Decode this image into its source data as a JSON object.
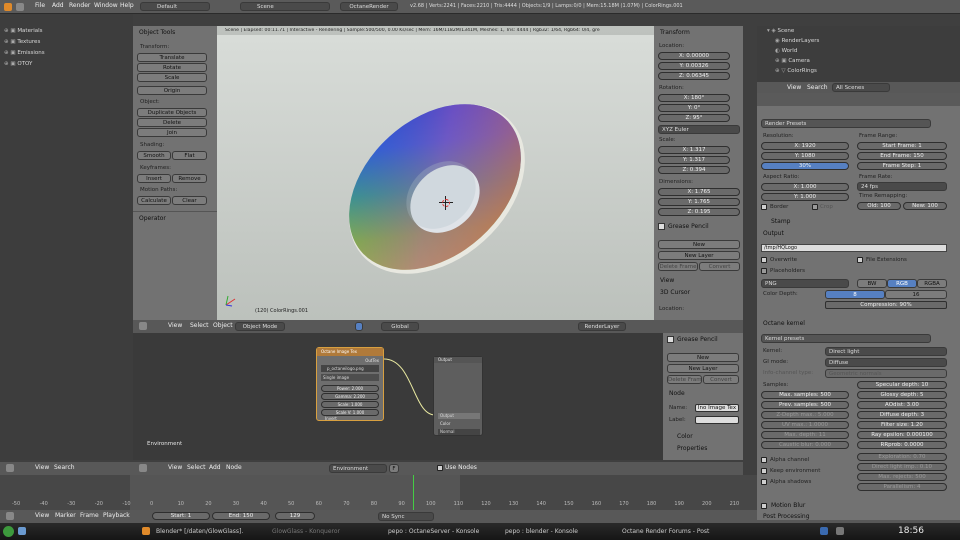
{
  "topbar": {
    "menus": [
      "File",
      "Add",
      "Render",
      "Window",
      "Help"
    ],
    "screen_layout": "Default",
    "scene": "Scene",
    "engine": "OctaneRender",
    "stats": "v2.68 | Verts:2241 | Faces:2210 | Tris:4444 | Objects:1/9 | Lamps:0/0 | Mem:15.18M (1.07M) | ColorRings.001",
    "window_title": "Blender* [/daten/GlowGlassLogo_3D.blend]"
  },
  "outliner_left": {
    "items": [
      "Materials",
      "Textures",
      "Emissions",
      "OTOY"
    ]
  },
  "tool_shelf": {
    "title": "Object Tools",
    "transform_label": "Transform:",
    "buttons_transform": [
      "Translate",
      "Rotate",
      "Scale"
    ],
    "origin": "Origin",
    "object_label": "Object:",
    "buttons_object": [
      "Duplicate Objects",
      "Delete",
      "Join"
    ],
    "shading_label": "Shading:",
    "smooth": "Smooth",
    "flat": "Flat",
    "keyframes_label": "Keyframes:",
    "insert": "Insert",
    "remove": "Remove",
    "motion_label": "Motion Paths:",
    "calculate": "Calculate",
    "clear": "Clear",
    "operator": "Operator"
  },
  "viewport": {
    "status": "Scene | Elapsed: 00:11.71 | Interactive - Rendering | Sample:500/500, 0.00 Ks/sec | Mem: 16M/1182M/1341M, Meshes: 1, Tris: 4444 | Rgb32: 1/64, Rgb64: 0/4, gre",
    "object_label": "(120) ColorRings.001"
  },
  "viewport_header": {
    "view": "View",
    "select": "Select",
    "object": "Object",
    "mode": "Object Mode",
    "orientation": "Global",
    "render_layer": "RenderLayer"
  },
  "n_panel": {
    "transform": "Transform",
    "location_label": "Location:",
    "loc": [
      "X: 0.00000",
      "Y: 0.00326",
      "Z: 0.06345"
    ],
    "rotation_label": "Rotation:",
    "rot": [
      "X: 180°",
      "Y: 0°",
      "Z: 95°"
    ],
    "euler": "XYZ Euler",
    "scale_label": "Scale:",
    "scale": [
      "X: 1.317",
      "Y: 1.317",
      "Z: 0.394"
    ],
    "dimensions_label": "Dimensions:",
    "dim": [
      "X: 1.765",
      "Y: 1.765",
      "Z: 0.195"
    ],
    "grease_pencil": "Grease Pencil",
    "new": "New",
    "new_layer": "New Layer",
    "delete_frame": "Delete Frame",
    "convert": "Convert",
    "view": "View",
    "cursor_3d": "3D Cursor",
    "location2": "Location:"
  },
  "node_editor": {
    "node1_title": "Octane Image Tex",
    "node1_out": "OutTex",
    "node1_file": "p_octaneilogo.png",
    "node1_type": "Single image",
    "node1_params": [
      "Power: 2.000",
      "Gamma: 2.200",
      "Scale: 1.000",
      "Scale V: 1.000"
    ],
    "node1_invert": "Invert",
    "node2_title": "Output",
    "node2_rows": [
      "Output",
      "Color",
      "Normal"
    ],
    "environment": "Environment",
    "side": {
      "grease": "Grease Pencil",
      "new": "New",
      "new_layer": "New Layer",
      "delete_frame": "Delete Frame",
      "convert": "Convert",
      "node": "Node",
      "name_label": "Name:",
      "name_value": "Ino Image Tex",
      "label_label": "Label:",
      "color": "Color",
      "properties": "Properties"
    },
    "header": {
      "view": "View",
      "select": "Select",
      "add": "Add",
      "node": "Node",
      "env": "Environment",
      "use_nodes": "Use Nodes",
      "frame": "F"
    }
  },
  "outliner_right": {
    "items": [
      "Scene",
      "RenderLayers",
      "World",
      "Camera",
      "ColorRings"
    ],
    "view": "View",
    "search": "Search",
    "all_scenes": "All Scenes"
  },
  "properties": {
    "render_presets": "Render Presets",
    "resolution": "Resolution:",
    "res_x": "X: 1920",
    "res_y": "Y: 1080",
    "res_pct": "30%",
    "frame_range": "Frame Range:",
    "start": "Start Frame: 1",
    "end": "End Frame: 150",
    "step": "Frame Step: 1",
    "aspect": "Aspect Ratio:",
    "asp_x": "X: 1.000",
    "asp_y": "Y: 1.000",
    "frame_rate": "Frame Rate:",
    "fps": "24 fps",
    "remap": "Time Remapping:",
    "old": "Old: 100",
    "new_val": "New: 100",
    "border": "Border",
    "crop": "Crop",
    "stamp": "Stamp",
    "output": "Output",
    "path": "/tmp/HQLogo",
    "overwrite": "Overwrite",
    "file_ext": "File Extensions",
    "placeholders": "Placeholders",
    "format": "PNG",
    "bw": "BW",
    "rgb": "RGB",
    "rgba": "RGBA",
    "color_depth": "Color Depth:",
    "d8": "8",
    "d16": "16",
    "compression": "Compression: 90%",
    "kernel": "Octane kernel",
    "kernel_presets": "Kernel presets",
    "kernel_label": "Kernel:",
    "kernel_val": "Direct light",
    "gimode_label": "GI mode:",
    "gimode_val": "Diffuse",
    "infochannel": "Info-channel type:",
    "infoval": "Geometric normals",
    "samples": "Samples:",
    "max_samples": "Max. samples: 500",
    "prev_samples": "Prev. samples: 500",
    "zdepth": "Z-Depth max.: 5.000",
    "uvmax": "UV max.: 1.0000",
    "maxdepth": "Max. depth: 11",
    "caustic": "Caustic blur: 0.000",
    "spec": "Specular depth: 10",
    "glossy": "Glossy depth: 5",
    "aodist": "AOdist: 3.00",
    "diffuse": "Diffuse depth: 3",
    "filter": "Filter size: 1.20",
    "ray_eps": "Ray epsilon: 0.000100",
    "rrprob": "RRprob: 0.0000",
    "exploration": "Exploration: 0.70",
    "direct_light_imp": "Direct light imp.: 0.10",
    "max_rejects": "Max. rejects: 500",
    "parallelism": "Parallelism: 4",
    "alpha": "Alpha channel",
    "keep_env": "Keep environment",
    "alpha_shadows": "Alpha shadows",
    "motion_blur": "Motion Blur",
    "post": "Post Processing"
  },
  "timeline": {
    "view": "View",
    "search": "Search",
    "marker": "Marker",
    "frame": "Frame",
    "playback": "Playback",
    "start": "Start: 1",
    "end": "End: 150",
    "current": "129",
    "sync": "No Sync",
    "ticks": [
      "-50",
      "-40",
      "-30",
      "-20",
      "-10",
      "0",
      "10",
      "20",
      "30",
      "40",
      "50",
      "60",
      "70",
      "80",
      "90",
      "100",
      "110",
      "120",
      "130",
      "140",
      "150",
      "160",
      "170",
      "180",
      "190",
      "200",
      "210",
      "220",
      "230",
      "240",
      "250",
      "260",
      "270",
      "280"
    ]
  },
  "taskbar": {
    "tasks": [
      "Blender* [/daten/GlowGlass].",
      "GlowGlass - Konqueror",
      "pepo : OctaneServer - Konsole",
      "pepo : blender - Konsole",
      "Octane Render Forums - Post"
    ],
    "time": "18:56"
  },
  "colors": {
    "accent": "#5680c2",
    "bg": "#3f3f3f",
    "viewport": "#c8cdc8"
  }
}
